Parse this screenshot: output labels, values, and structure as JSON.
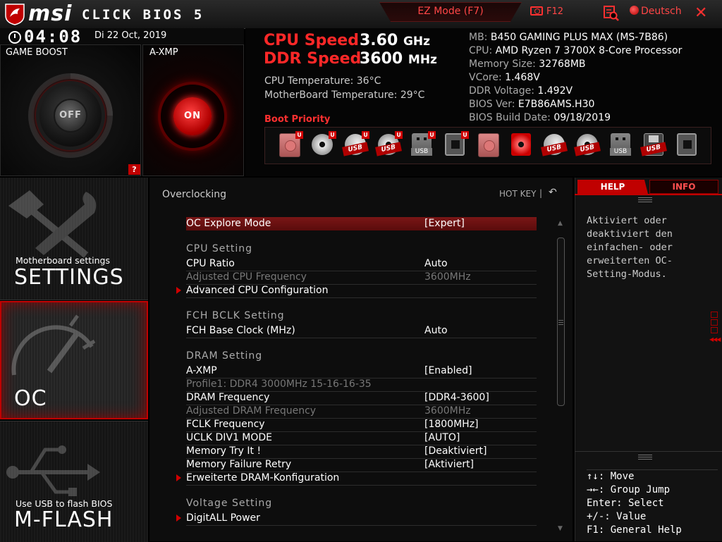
{
  "header": {
    "brand": "msi",
    "product": "CLICK BIOS 5",
    "ez_mode": "EZ Mode (F7)",
    "screenshot_key": "F12",
    "language": "Deutsch",
    "close": "✕"
  },
  "clock": {
    "time": "04:08",
    "date": "Di  22 Oct, 2019"
  },
  "game_boost": {
    "label": "GAME BOOST",
    "state": "OFF",
    "help": "?"
  },
  "axmp": {
    "label": "A-XMP",
    "state": "ON"
  },
  "speeds": {
    "cpu_label": "CPU Speed",
    "cpu_value": "3.60",
    "cpu_unit": "GHz",
    "ddr_label": "DDR Speed",
    "ddr_value": "3600",
    "ddr_unit": "MHz"
  },
  "temps": {
    "cpu": "CPU Temperature: 36°C",
    "mb": "MotherBoard Temperature: 29°C"
  },
  "sysinfo": [
    {
      "key": "MB:",
      "value": "B450 GAMING PLUS MAX (MS-7B86)"
    },
    {
      "key": "CPU:",
      "value": "AMD Ryzen 7 3700X 8-Core Processor"
    },
    {
      "key": "Memory Size:",
      "value": "32768MB"
    },
    {
      "key": "VCore:",
      "value": "1.468V"
    },
    {
      "key": "DDR Voltage:",
      "value": "1.492V"
    },
    {
      "key": "BIOS Ver:",
      "value": "E7B86AMS.H30"
    },
    {
      "key": "BIOS Build Date:",
      "value": "09/18/2019"
    }
  ],
  "boot_priority": {
    "label": "Boot Priority",
    "badge": "U",
    "usb_tag": "USB",
    "devices": [
      {
        "type": "hdd",
        "icon": "hard-disk-icon",
        "uefi": true,
        "tag": ""
      },
      {
        "type": "cd",
        "icon": "optical-disc-icon",
        "uefi": true,
        "tag": ""
      },
      {
        "type": "usbhdd",
        "icon": "usb-hard-disk-icon",
        "uefi": true,
        "tag": "USB"
      },
      {
        "type": "usbcd",
        "icon": "usb-optical-disc-icon",
        "uefi": true,
        "tag": "USB"
      },
      {
        "type": "usbkey",
        "icon": "usb-key-icon",
        "uefi": true,
        "tag": "USB"
      },
      {
        "type": "net",
        "icon": "network-icon",
        "uefi": true,
        "tag": ""
      },
      {
        "type": "hdd",
        "icon": "hard-disk-icon",
        "uefi": false,
        "tag": ""
      },
      {
        "type": "cd-red",
        "icon": "optical-disc-icon",
        "uefi": false,
        "tag": ""
      },
      {
        "type": "usbhdd",
        "icon": "usb-hard-disk-icon",
        "uefi": false,
        "tag": "USB"
      },
      {
        "type": "usbcd",
        "icon": "usb-optical-disc-icon",
        "uefi": false,
        "tag": "USB"
      },
      {
        "type": "usbkey",
        "icon": "usb-key-icon",
        "uefi": false,
        "tag": "USB"
      },
      {
        "type": "floppy",
        "icon": "usb-floppy-icon",
        "uefi": false,
        "tag": "USB"
      },
      {
        "type": "net",
        "icon": "network-icon",
        "uefi": false,
        "tag": ""
      }
    ]
  },
  "nav": {
    "settings_sub": "Motherboard settings",
    "settings": "SETTINGS",
    "oc": "OC",
    "mflash_sub": "Use USB to flash BIOS",
    "mflash": "M-FLASH"
  },
  "main": {
    "title": "Overclocking",
    "hotkey": "HOT KEY",
    "hotkey_sep": "|",
    "undo": "↶",
    "items": [
      {
        "kind": "row",
        "label": "OC Explore Mode",
        "value": "[Expert]",
        "selected": true
      },
      {
        "kind": "section",
        "label": "CPU  Setting"
      },
      {
        "kind": "row",
        "label": "CPU Ratio",
        "value": "Auto"
      },
      {
        "kind": "row",
        "label": "Adjusted CPU Frequency",
        "value": "3600MHz",
        "dim": true
      },
      {
        "kind": "row",
        "label": "Advanced CPU Configuration",
        "value": "",
        "submenu": true
      },
      {
        "kind": "section",
        "label": "FCH BCLK  Setting"
      },
      {
        "kind": "row",
        "label": "FCH Base Clock (MHz)",
        "value": "Auto"
      },
      {
        "kind": "section",
        "label": "DRAM  Setting"
      },
      {
        "kind": "row",
        "label": "A-XMP",
        "value": "[Enabled]"
      },
      {
        "kind": "row",
        "label": "Profile1: DDR4 3000MHz 15-16-16-35",
        "value": "",
        "dim": true
      },
      {
        "kind": "row",
        "label": "DRAM Frequency",
        "value": "[DDR4-3600]"
      },
      {
        "kind": "row",
        "label": "Adjusted DRAM Frequency",
        "value": "3600MHz",
        "dim": true
      },
      {
        "kind": "row",
        "label": "FCLK Frequency",
        "value": "[1800MHz]"
      },
      {
        "kind": "row",
        "label": "UCLK DIV1 MODE",
        "value": "[AUTO]"
      },
      {
        "kind": "row",
        "label": "Memory Try It !",
        "value": "[Deaktiviert]"
      },
      {
        "kind": "row",
        "label": "Memory Failure Retry",
        "value": "[Aktiviert]"
      },
      {
        "kind": "row",
        "label": "Erweiterte DRAM-Konfiguration",
        "value": "",
        "submenu": true
      },
      {
        "kind": "section",
        "label": "Voltage  Setting"
      },
      {
        "kind": "row",
        "label": "DigitALL Power",
        "value": "",
        "submenu": true
      }
    ]
  },
  "help": {
    "tab_help": "HELP",
    "tab_info": "INFO",
    "text": "Aktiviert oder deaktiviert den einfachen- oder erweiterten OC-Setting-Modus.",
    "keys": [
      "↑↓: Move",
      "→←: Group Jump",
      "Enter: Select",
      "+/-: Value",
      "F1: General Help"
    ]
  },
  "colors": {
    "accent": "#c00000",
    "brand_red": "#ff2828",
    "background": "#0d0d0d"
  }
}
